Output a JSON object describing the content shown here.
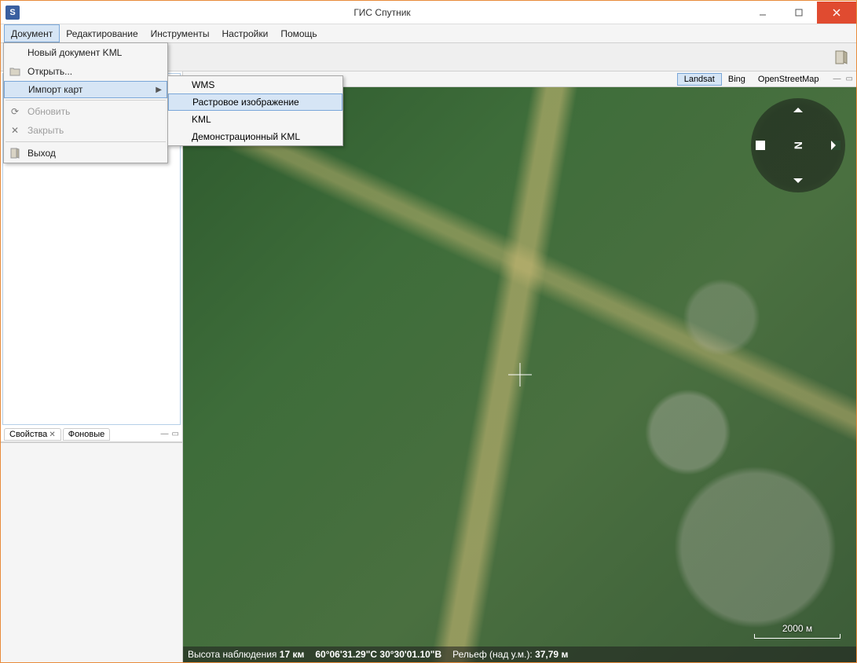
{
  "window": {
    "title": "ГИС Спутник"
  },
  "menubar": {
    "items": [
      "Документ",
      "Редактирование",
      "Инструменты",
      "Настройки",
      "Помощь"
    ]
  },
  "menu": {
    "new_kml": "Новый документ KML",
    "open": "Открыть...",
    "import_maps": "Импорт карт",
    "refresh": "Обновить",
    "close": "Закрыть",
    "exit": "Выход"
  },
  "submenu": {
    "wms": "WMS",
    "raster": "Растровое изображение",
    "kml": "KML",
    "demo_kml": "Демонстрационный KML"
  },
  "maptabs": {
    "items": [
      "Landsat",
      "Bing",
      "OpenStreetMap"
    ]
  },
  "left_panel": {
    "tab1": "Свойства",
    "tab2": "Фоновые"
  },
  "compass": {
    "letter": "N"
  },
  "scale": {
    "label": "2000 м"
  },
  "status": {
    "alt_label": "Высота наблюдения",
    "alt_value": "17 км",
    "coords": "60°06'31.29\"С 30°30'01.10\"В",
    "relief_label": "Рельеф (над у.м.):",
    "relief_value": "37,79 м"
  }
}
